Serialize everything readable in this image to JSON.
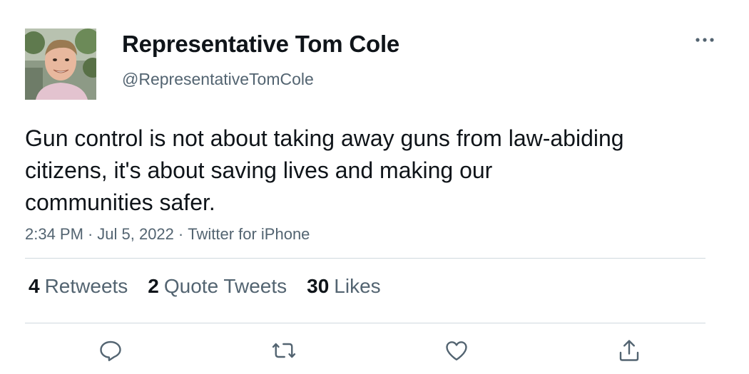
{
  "author": {
    "display_name": "Representative Tom Cole",
    "handle": "@RepresentativeTomCole"
  },
  "tweet": {
    "text": "Gun control is not about taking away guns from law-abiding citizens, it's about saving lives and making our communities safer.",
    "time": "2:34 PM",
    "date": "Jul 5, 2022",
    "source": "Twitter for iPhone",
    "separator": "·"
  },
  "stats": {
    "retweets_count": "4",
    "retweets_label": "Retweets",
    "quotes_count": "2",
    "quotes_label": "Quote Tweets",
    "likes_count": "30",
    "likes_label": "Likes"
  },
  "icons": {
    "more": "more-horizontal-icon",
    "reply": "reply-icon",
    "retweet": "retweet-icon",
    "like": "heart-icon",
    "share": "share-icon"
  },
  "colors": {
    "text_primary": "#0f1419",
    "text_secondary": "#536471",
    "divider": "#cfd9de",
    "icon": "#536471"
  }
}
